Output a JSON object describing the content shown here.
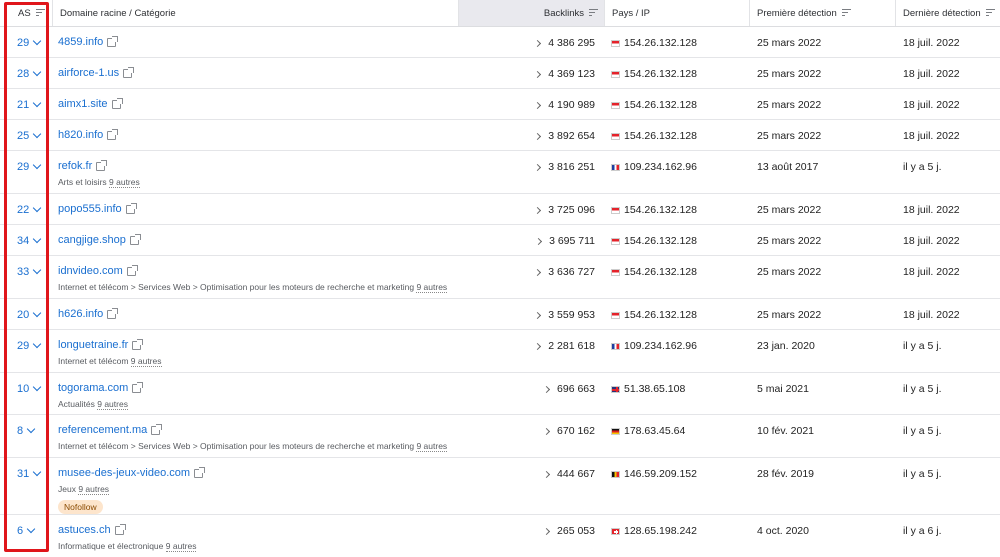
{
  "header": {
    "as": "AS",
    "domain": "Domaine racine / Catégorie",
    "backlinks": "Backlinks",
    "country_ip": "Pays / IP",
    "first_seen": "Première détection",
    "last_seen": "Dernière détection"
  },
  "nofollow_label": "Nofollow",
  "rows": [
    {
      "as": "29",
      "domain": "4859.info",
      "category": "",
      "more": "",
      "backlinks": "4 386 295",
      "flag": "sg",
      "ip": "154.26.132.128",
      "first": "25 mars 2022",
      "last": "18 juil. 2022"
    },
    {
      "as": "28",
      "domain": "airforce-1.us",
      "category": "",
      "more": "",
      "backlinks": "4 369 123",
      "flag": "sg",
      "ip": "154.26.132.128",
      "first": "25 mars 2022",
      "last": "18 juil. 2022"
    },
    {
      "as": "21",
      "domain": "aimx1.site",
      "category": "",
      "more": "",
      "backlinks": "4 190 989",
      "flag": "sg",
      "ip": "154.26.132.128",
      "first": "25 mars 2022",
      "last": "18 juil. 2022"
    },
    {
      "as": "25",
      "domain": "h820.info",
      "category": "",
      "more": "",
      "backlinks": "3 892 654",
      "flag": "sg",
      "ip": "154.26.132.128",
      "first": "25 mars 2022",
      "last": "18 juil. 2022"
    },
    {
      "as": "29",
      "domain": "refok.fr",
      "category": "Arts et loisirs",
      "more": "9 autres",
      "backlinks": "3 816 251",
      "flag": "fr",
      "ip": "109.234.162.96",
      "first": "13 août 2017",
      "last": "il y a 5 j."
    },
    {
      "as": "22",
      "domain": "popo555.info",
      "category": "",
      "more": "",
      "backlinks": "3 725 096",
      "flag": "sg",
      "ip": "154.26.132.128",
      "first": "25 mars 2022",
      "last": "18 juil. 2022"
    },
    {
      "as": "34",
      "domain": "cangjige.shop",
      "category": "",
      "more": "",
      "backlinks": "3 695 711",
      "flag": "sg",
      "ip": "154.26.132.128",
      "first": "25 mars 2022",
      "last": "18 juil. 2022"
    },
    {
      "as": "33",
      "domain": "idnvideo.com",
      "category": "Internet et télécom > Services Web > Optimisation pour les moteurs de recherche et marketing",
      "more": "9 autres",
      "backlinks": "3 636 727",
      "flag": "sg",
      "ip": "154.26.132.128",
      "first": "25 mars 2022",
      "last": "18 juil. 2022"
    },
    {
      "as": "20",
      "domain": "h626.info",
      "category": "",
      "more": "",
      "backlinks": "3 559 953",
      "flag": "sg",
      "ip": "154.26.132.128",
      "first": "25 mars 2022",
      "last": "18 juil. 2022"
    },
    {
      "as": "29",
      "domain": "longuetraine.fr",
      "category": "Internet et télécom",
      "more": "9 autres",
      "backlinks": "2 281 618",
      "flag": "fr",
      "ip": "109.234.162.96",
      "first": "23 jan. 2020",
      "last": "il y a 5 j."
    },
    {
      "as": "10",
      "domain": "togorama.com",
      "category": "Actualités",
      "more": "9 autres",
      "backlinks": "696 663",
      "flag": "gb",
      "ip": "51.38.65.108",
      "first": "5 mai 2021",
      "last": "il y a 5 j."
    },
    {
      "as": "8",
      "domain": "referencement.ma",
      "category": "Internet et télécom > Services Web > Optimisation pour les moteurs de recherche et marketing",
      "more": "9 autres",
      "backlinks": "670 162",
      "flag": "de",
      "ip": "178.63.45.64",
      "first": "10 fév. 2021",
      "last": "il y a 5 j."
    },
    {
      "as": "31",
      "domain": "musee-des-jeux-video.com",
      "category": "Jeux",
      "more": "9 autres",
      "nofollow": true,
      "backlinks": "444 667",
      "flag": "be",
      "ip": "146.59.209.152",
      "first": "28 fév. 2019",
      "last": "il y a 5 j."
    },
    {
      "as": "6",
      "domain": "astuces.ch",
      "category": "Informatique et électronique",
      "more": "9 autres",
      "backlinks": "265 053",
      "flag": "ch",
      "ip": "128.65.198.242",
      "first": "4 oct. 2020",
      "last": "il y a 6 j."
    }
  ]
}
